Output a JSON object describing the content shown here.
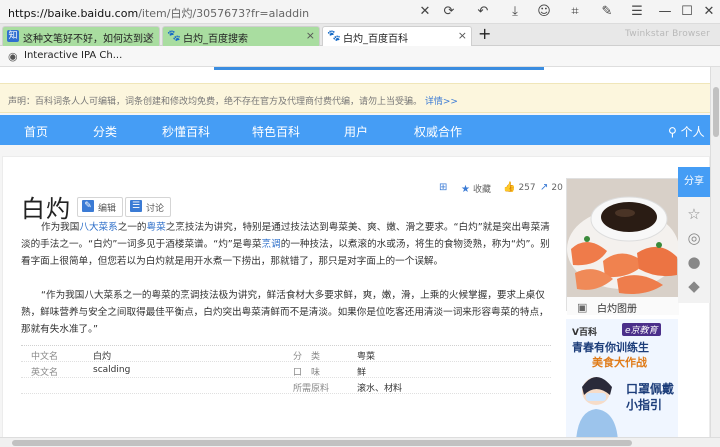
{
  "browser": {
    "url_host": "https://baike.baidu.com",
    "url_path": "/item/白灼/3057673?fr=aladdin",
    "tabs": [
      {
        "label": "这种文笔好不好，如何达到这",
        "favicon": "知",
        "active": false
      },
      {
        "label": "白灼_百度搜索",
        "favicon": "paw",
        "active": false
      },
      {
        "label": "白灼_百度百科",
        "favicon": "paw",
        "active": true
      }
    ],
    "new_tab": "+",
    "brand": "Twinkstar Browser",
    "bookmark": "Interactive IPA Ch..."
  },
  "notice": {
    "text": "声明：百科词条人人可编辑，词条创建和修改均免费，绝不存在官方及代理商付费代编，请勿上当受骗。",
    "more": "详情>>"
  },
  "nav": [
    "首页",
    "分类",
    "秒懂百科",
    "特色百科",
    "用户",
    "权威合作"
  ],
  "nav_user": "个人",
  "entry": {
    "title": "白灼",
    "edit": "编辑",
    "discuss": "讨论",
    "collect": "收藏",
    "likes": "257",
    "shares": "20"
  },
  "para1": {
    "p1": "作为我国",
    "link1": "八大菜系",
    "p2": "之一的",
    "link2": "粤菜",
    "p3": "之烹技法为讲究，特别是通过技法达到粤菜美、爽、嫩、滑之要求。“白灼”就是突出粤菜清淡的手法之一。“白灼”一词多见于酒楼菜谱。“灼”是粤菜",
    "link3": "烹调",
    "p4": "的一种技法，以煮滚的水或汤，将生的食物烫熟，称为“灼”。别看字面上很简单，但您若以为白灼就是用开水煮一下捞出，那就错了，那只是对字面上的一个误解。"
  },
  "para2": "“作为我国八大菜系之一的粤菜的烹调技法极为讲究，鲜活食材大多要求鲜，爽，嫩，滑，上乘的火候掌握，要求上桌仅熟，鲜味营养与安全之间取得最佳平衡点，白灼突出粤菜清鲜而不是清淡。如果你是位吃客还用清淡一词来形容粤菜的特点，那就有失水准了。”",
  "info": [
    {
      "k1": "中文名",
      "v1": "白灼",
      "k2": "分　类",
      "v2": "粤菜"
    },
    {
      "k1": "英文名",
      "v1": "scalding",
      "k2": "口　味",
      "v2": "鲜"
    },
    {
      "k1": "",
      "v1": "",
      "k2": "所需原料",
      "v2": "滚水、材料"
    }
  ],
  "album": "白灼图册",
  "share": "分享",
  "ad": {
    "brand": "V百科",
    "tag": "e京教育",
    "line1": "青春有你训练生",
    "line2": "美食大作战",
    "line3": "口罩佩戴小指引"
  },
  "colors": {
    "nav_blue": "#459df5",
    "link_blue": "#2e6fc9",
    "notice_bg": "#fcf6dd"
  }
}
